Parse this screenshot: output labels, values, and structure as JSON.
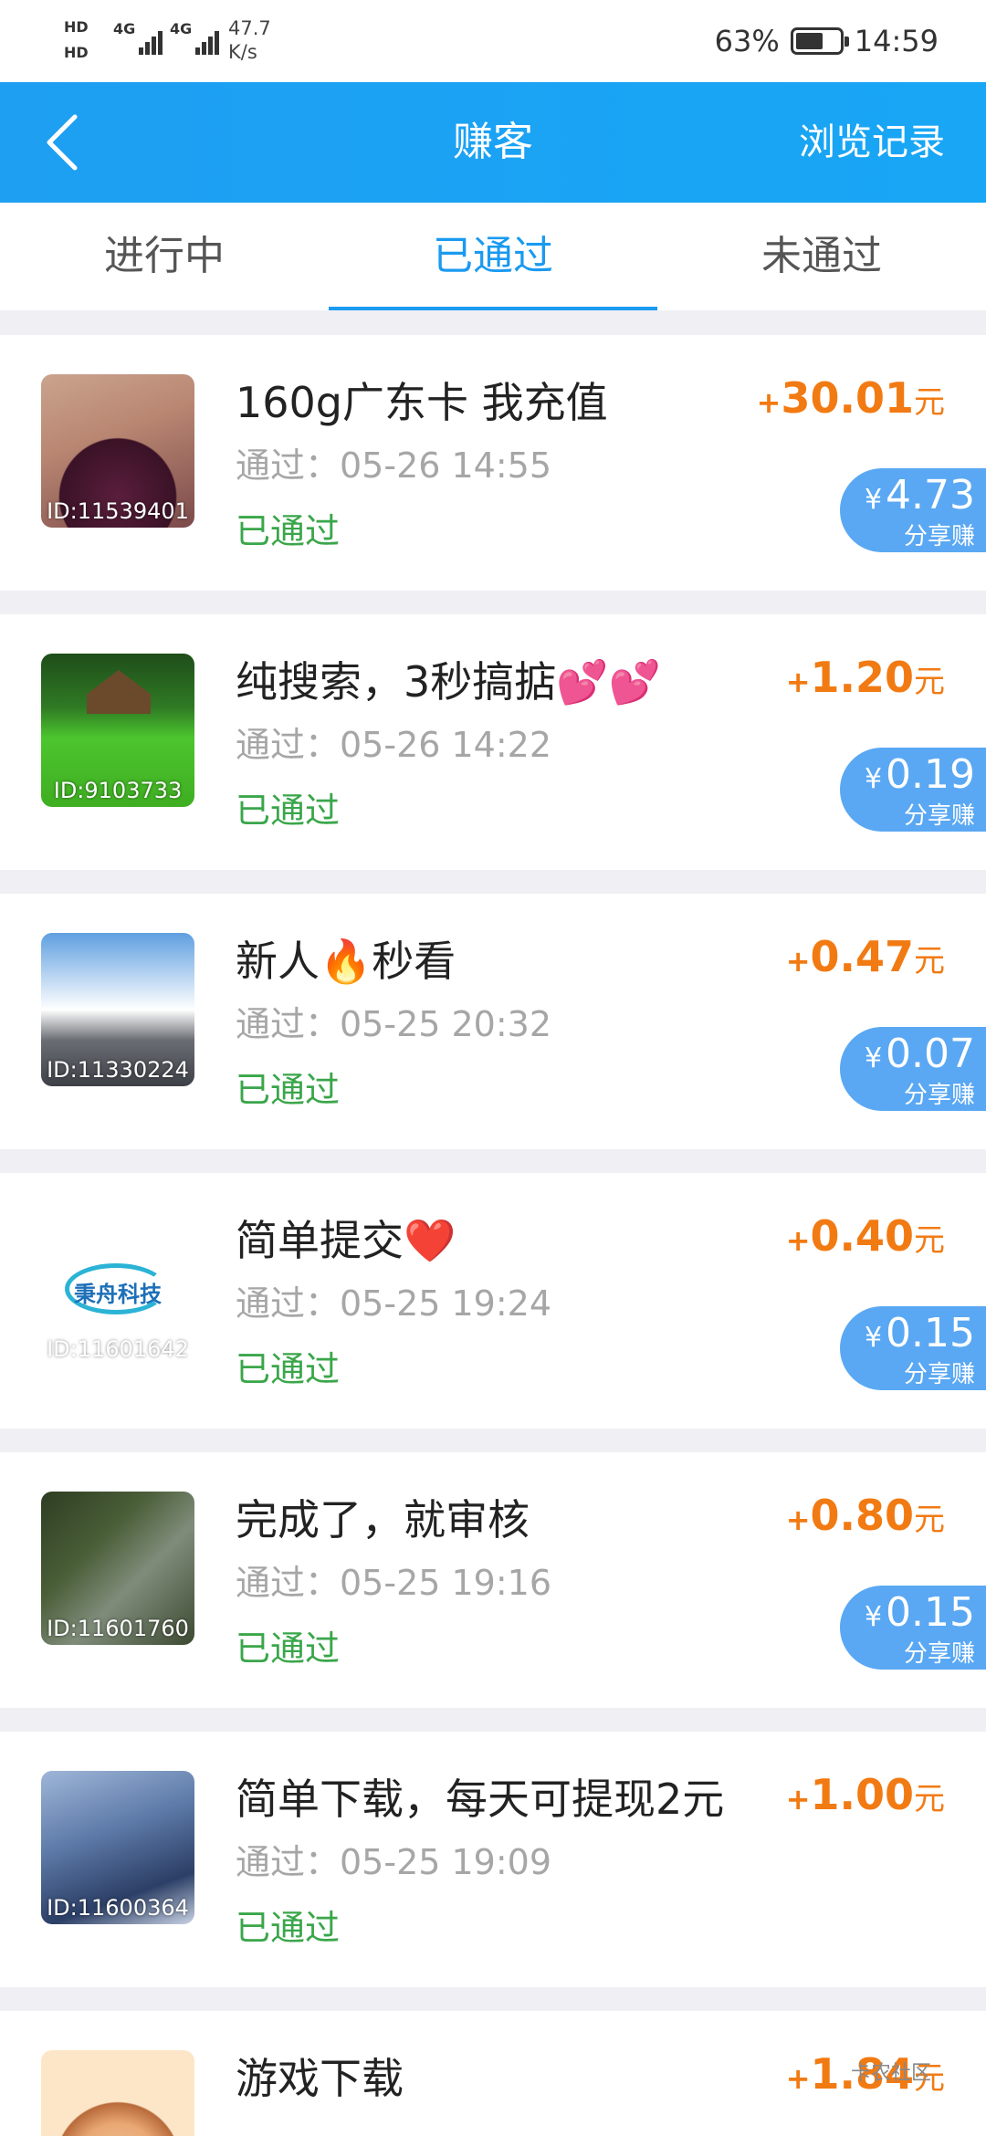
{
  "status_bar": {
    "hd1": "HD",
    "hd2": "HD",
    "net1": "4G",
    "net2": "4G",
    "speed_value": "47.7",
    "speed_unit": "K/s",
    "battery_percent": "63%",
    "battery_level": 0.63,
    "time": "14:59"
  },
  "header": {
    "title": "赚客",
    "right_label": "浏览记录"
  },
  "tabs": [
    {
      "label": "进行中"
    },
    {
      "label": "已通过"
    },
    {
      "label": "未通过"
    }
  ],
  "active_tab": "已通过",
  "colors": {
    "header_blue": "#1e9ff2",
    "tab_active": "#1a9af0",
    "amount_orange": "#f27a12",
    "status_green": "#3aa64a",
    "share_badge": "#5aa8f3"
  },
  "tasks": [
    {
      "id": "ID:11539401",
      "title": "160g广东卡 我充值",
      "passed": "通过：05-26 14:55",
      "status": "已通过",
      "plus": "+",
      "amount": "30.01",
      "unit": "元",
      "yen": "¥",
      "share": "4.73",
      "share_label": "分享赚"
    },
    {
      "id": "ID:9103733",
      "title": "纯搜索，3秒搞掂💕💕",
      "passed": "通过：05-26 14:22",
      "status": "已通过",
      "plus": "+",
      "amount": "1.20",
      "unit": "元",
      "yen": "¥",
      "share": "0.19",
      "share_label": "分享赚"
    },
    {
      "id": "ID:11330224",
      "title": "新人🔥秒看",
      "passed": "通过：05-25 20:32",
      "status": "已通过",
      "plus": "+",
      "amount": "0.47",
      "unit": "元",
      "yen": "¥",
      "share": "0.07",
      "share_label": "分享赚"
    },
    {
      "id": "ID:11601642",
      "title": "简单提交❤️",
      "passed": "通过：05-25 19:24",
      "status": "已通过",
      "plus": "+",
      "amount": "0.40",
      "unit": "元",
      "yen": "¥",
      "share": "0.15",
      "share_label": "分享赚",
      "logo_text": "秉舟科技"
    },
    {
      "id": "ID:11601760",
      "title": "完成了，就审核",
      "passed": "通过：05-25 19:16",
      "status": "已通过",
      "plus": "+",
      "amount": "0.80",
      "unit": "元",
      "yen": "¥",
      "share": "0.15",
      "share_label": "分享赚"
    },
    {
      "id": "ID:11600364",
      "title": "简单下载，每天可提现2元",
      "passed": "通过：05-25 19:09",
      "status": "已通过",
      "plus": "+",
      "amount": "1.00",
      "unit": "元"
    },
    {
      "title": "游戏下载",
      "plus": "+",
      "amount": "1.84",
      "unit": "元",
      "watermark": "卡农社区"
    }
  ]
}
